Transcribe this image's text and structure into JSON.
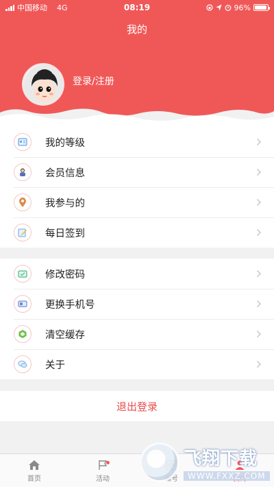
{
  "status_bar": {
    "carrier": "中国移动",
    "network": "4G",
    "time": "08:19",
    "battery": "96%",
    "battery_level": 0.96
  },
  "header": {
    "title": "我的",
    "login_text": "登录/注册"
  },
  "menu_group_1": [
    {
      "label": "我的等级",
      "icon": "level-card-icon"
    },
    {
      "label": "会员信息",
      "icon": "member-person-icon"
    },
    {
      "label": "我参与的",
      "icon": "location-pin-icon"
    },
    {
      "label": "每日签到",
      "icon": "sign-in-pencil-icon"
    }
  ],
  "menu_group_2": [
    {
      "label": "修改密码",
      "icon": "password-icon"
    },
    {
      "label": "更换手机号",
      "icon": "phone-card-icon"
    },
    {
      "label": "清空缓存",
      "icon": "clear-cache-icon"
    },
    {
      "label": "关于",
      "icon": "about-chat-icon"
    }
  ],
  "logout_label": "退出登录",
  "tabbar": {
    "tabs": [
      {
        "label": "首页",
        "icon": "home-icon"
      },
      {
        "label": "活动",
        "icon": "flag-icon"
      },
      {
        "label": "编号",
        "icon": "grid-icon"
      },
      {
        "label": "我的",
        "icon": "profile-icon"
      }
    ],
    "active_index": 3
  },
  "watermark": {
    "big": "飞翔下载",
    "small": "WWW.FXXZ.COM"
  },
  "colors": {
    "primary": "#f05858",
    "logout_text": "#e94d4d",
    "background": "#f1f1f1"
  }
}
